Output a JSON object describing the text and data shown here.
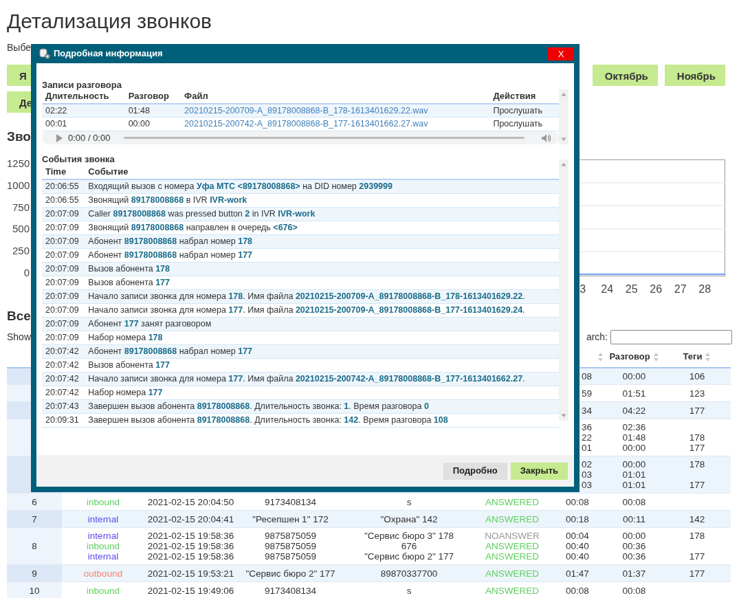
{
  "page_title": "Детализация звонков",
  "select_label": "Выбе",
  "month_rows": [
    [
      "Я",
      "Октябрь",
      "Ноябрь"
    ],
    [
      "Де"
    ]
  ],
  "chart_heading": "Зво",
  "chart": {
    "y_labels": [
      "1250",
      "1000",
      "750",
      "500",
      "250",
      "0"
    ],
    "x_labels": [
      "3",
      "24",
      "25",
      "26",
      "27",
      "28"
    ]
  },
  "table_heading": "Все",
  "show_label": "Show",
  "search_label": "arch:",
  "table": {
    "columns": [
      "Разговор",
      "Теги"
    ],
    "rows": [
      {
        "legs": [
          {
            "duration": "08",
            "talk": "00:00",
            "tag": "106"
          }
        ]
      },
      {
        "legs": [
          {
            "duration": "59",
            "talk": "01:51",
            "tag": "123"
          }
        ]
      },
      {
        "legs": [
          {
            "duration": "34",
            "talk": "04:22",
            "tag": "177"
          }
        ]
      },
      {
        "legs": [
          {
            "duration": "36",
            "talk": "02:36"
          },
          {
            "duration": "22",
            "talk": "01:48",
            "tag": "178"
          },
          {
            "duration": "01",
            "talk": "00:00",
            "tag": "177"
          }
        ]
      },
      {
        "legs": [
          {
            "duration": "02",
            "talk": "00:00",
            "tag": "178"
          },
          {
            "duration": "03",
            "talk": "01:01"
          },
          {
            "duration": "03",
            "talk": "01:01",
            "tag": "177"
          }
        ]
      },
      {
        "index": "6",
        "legs": [
          {
            "type": "inbound",
            "color": "#5fcf5f",
            "date": "2021-02-15 20:04:50",
            "from": "9173408134",
            "to": "s",
            "status": "ANSWERED",
            "answered": true,
            "duration": "00:08",
            "talk": "00:08"
          }
        ]
      },
      {
        "index": "7",
        "legs": [
          {
            "type": "internal",
            "color": "#5a48ea",
            "date": "2021-02-15 20:04:41",
            "from": "\"Ресепшен 1\" 172",
            "to": "\"Охрана\" 142",
            "status": "ANSWERED",
            "answered": true,
            "duration": "00:18",
            "talk": "00:11",
            "tag": "142"
          }
        ]
      },
      {
        "index": "8",
        "legs": [
          {
            "type": "internal",
            "color": "#5a48ea",
            "date": "2021-02-15 19:58:36",
            "from": "9875875059",
            "to": "\"Сервис бюро 3\" 178",
            "status": "NOANSWER",
            "answered": false,
            "duration": "00:04",
            "talk": "00:00",
            "tag": "178"
          },
          {
            "type": "inbound",
            "color": "#5fcf5f",
            "date": "2021-02-15 19:58:36",
            "from": "9875875059",
            "to": "676",
            "status": "ANSWERED",
            "answered": true,
            "duration": "00:40",
            "talk": "00:36"
          },
          {
            "type": "internal",
            "color": "#5a48ea",
            "date": "2021-02-15 19:58:36",
            "from": "9875875059",
            "to": "\"Сервис бюро 2\" 177",
            "status": "ANSWERED",
            "answered": true,
            "duration": "00:40",
            "talk": "00:36",
            "tag": "177"
          }
        ]
      },
      {
        "index": "9",
        "legs": [
          {
            "type": "outbound",
            "color": "#f4846c",
            "date": "2021-02-15 19:53:21",
            "from": "\"Сервис бюро 2\" 177",
            "to": "89870337700",
            "status": "ANSWERED",
            "answered": true,
            "duration": "01:47",
            "talk": "01:37",
            "tag": "177"
          }
        ]
      },
      {
        "index": "10",
        "legs": [
          {
            "type": "inbound",
            "color": "#5fcf5f",
            "date": "2021-02-15 19:49:06",
            "from": "9173408134",
            "to": "s",
            "status": "ANSWERED",
            "answered": true,
            "duration": "00:08",
            "talk": "00:08"
          }
        ]
      }
    ]
  },
  "modal": {
    "title": "Подробная информация",
    "close": "X",
    "records": {
      "heading": "Записи разговора",
      "columns": [
        "Длительность",
        "Разговор",
        "Файл",
        "Действия"
      ],
      "rows": [
        {
          "duration": "02:22",
          "talk": "01:48",
          "file": "20210215-200709-A_89178008868-B_178-1613401629.22.wav",
          "action": "Прослушать"
        },
        {
          "duration": "00:01",
          "talk": "00:00",
          "file": "20210215-200742-A_89178008868-B_177-1613401662.27.wav",
          "action": "Прослушать"
        }
      ],
      "player_time": "0:00 / 0:00"
    },
    "events": {
      "heading": "События звонка",
      "columns": [
        "Time",
        "Событие"
      ],
      "rows": [
        {
          "time": "20:06:55",
          "text": "Входящий вызов с номера **Уфа МТС <89178008868>** на DID номер **2939999**"
        },
        {
          "time": "20:06:55",
          "text": "Звонящий **89178008868** в IVR **IVR-work**"
        },
        {
          "time": "20:07:09",
          "text": "Caller **89178008868** was pressed button **2** in IVR **IVR-work**"
        },
        {
          "time": "20:07:09",
          "text": "Звонящий **89178008868** направлен в очередь **<676>**"
        },
        {
          "time": "20:07:09",
          "text": "Абонент **89178008868** набрал номер **178**"
        },
        {
          "time": "20:07:09",
          "text": "Абонент **89178008868** набрал номер **177**"
        },
        {
          "time": "20:07:09",
          "text": "Вызов абонента **178**"
        },
        {
          "time": "20:07:09",
          "text": "Вызов абонента **177**"
        },
        {
          "time": "20:07:09",
          "text": "Начало записи звонка для номера **178**. Имя файла **20210215-200709-A_89178008868-B_178-1613401629.22**."
        },
        {
          "time": "20:07:09",
          "text": "Начало записи звонка для номера **177**. Имя файла **20210215-200709-A_89178008868-B_177-1613401629.24**."
        },
        {
          "time": "20:07:09",
          "text": "Абонент **177** занят разговором"
        },
        {
          "time": "20:07:09",
          "text": "Набор номера **178**"
        },
        {
          "time": "20:07:42",
          "text": "Абонент **89178008868** набрал номер **177**"
        },
        {
          "time": "20:07:42",
          "text": "Вызов абонента **177**"
        },
        {
          "time": "20:07:42",
          "text": "Начало записи звонка для номера **177**. Имя файла **20210215-200742-A_89178008868-B_177-1613401662.27**."
        },
        {
          "time": "20:07:42",
          "text": "Набор номера **177**"
        },
        {
          "time": "20:07:43",
          "text": "Завершен вызов абонента **89178008868**. Длительность звонка: **1**. Время разговора **0**"
        },
        {
          "time": "20:09:31",
          "text": "Завершен вызов абонента **89178008868**. Длительность звонка: **142**. Время разговора **108**"
        }
      ]
    },
    "buttons": [
      {
        "label": "Подробно",
        "kind": "default"
      },
      {
        "label": "Закрыть",
        "kind": "primary"
      }
    ]
  }
}
